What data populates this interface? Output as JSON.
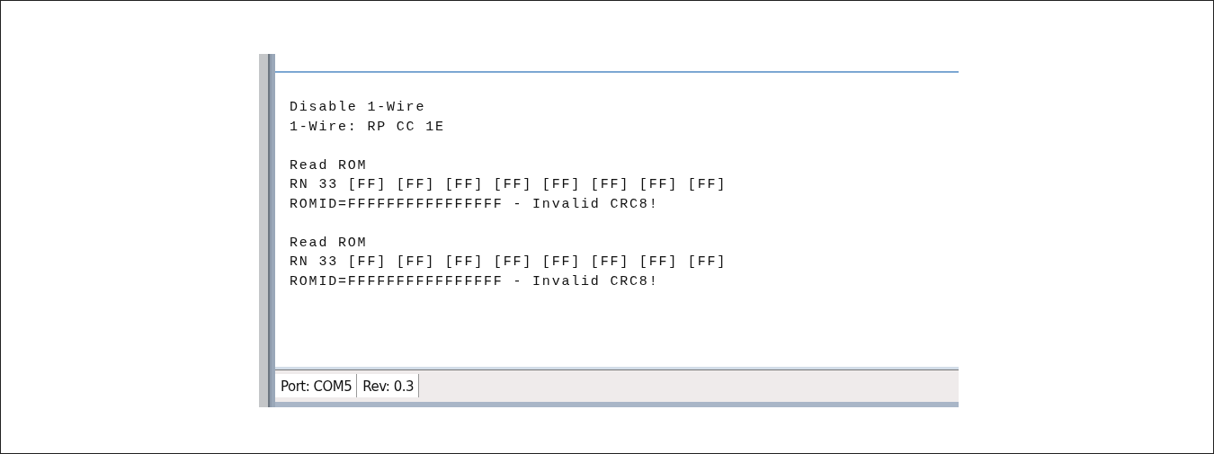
{
  "log": {
    "blocks": [
      [
        "Disable 1-Wire",
        "1-Wire: RP CC 1E"
      ],
      [
        "Read ROM",
        "RN 33 [FF] [FF] [FF] [FF] [FF] [FF] [FF] [FF]",
        "ROMID=FFFFFFFFFFFFFFFF - Invalid CRC8!"
      ],
      [
        "Read ROM",
        "RN 33 [FF] [FF] [FF] [FF] [FF] [FF] [FF] [FF]",
        "ROMID=FFFFFFFFFFFFFFFF - Invalid CRC8!"
      ]
    ]
  },
  "status_bar": [
    "Port: COM5",
    "Rev: 0.3"
  ]
}
